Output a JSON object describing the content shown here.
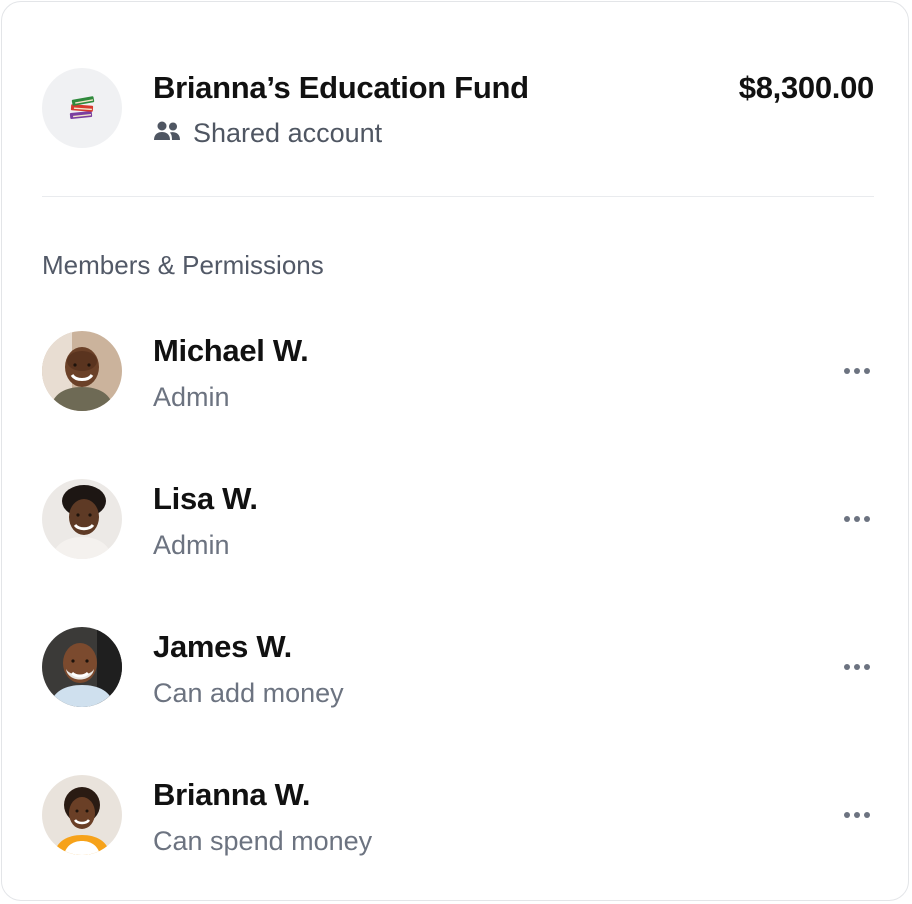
{
  "account": {
    "title": "Brianna’s Education Fund",
    "subtitle": "Shared account",
    "amount": "$8,300.00",
    "icon": "books-icon",
    "subtitle_icon": "people-icon"
  },
  "section_title": "Members & Permissions",
  "members": [
    {
      "name": "Michael W.",
      "role": "Admin",
      "avatar": "avatar-michael"
    },
    {
      "name": "Lisa W.",
      "role": "Admin",
      "avatar": "avatar-lisa"
    },
    {
      "name": "James W.",
      "role": "Can add money",
      "avatar": "avatar-james"
    },
    {
      "name": "Brianna W.",
      "role": "Can spend money",
      "avatar": "avatar-brianna"
    }
  ],
  "colors": {
    "text_primary": "#111111",
    "text_secondary": "#6c7380",
    "border": "#e3e5e8",
    "icon_bg": "#f0f1f3"
  }
}
